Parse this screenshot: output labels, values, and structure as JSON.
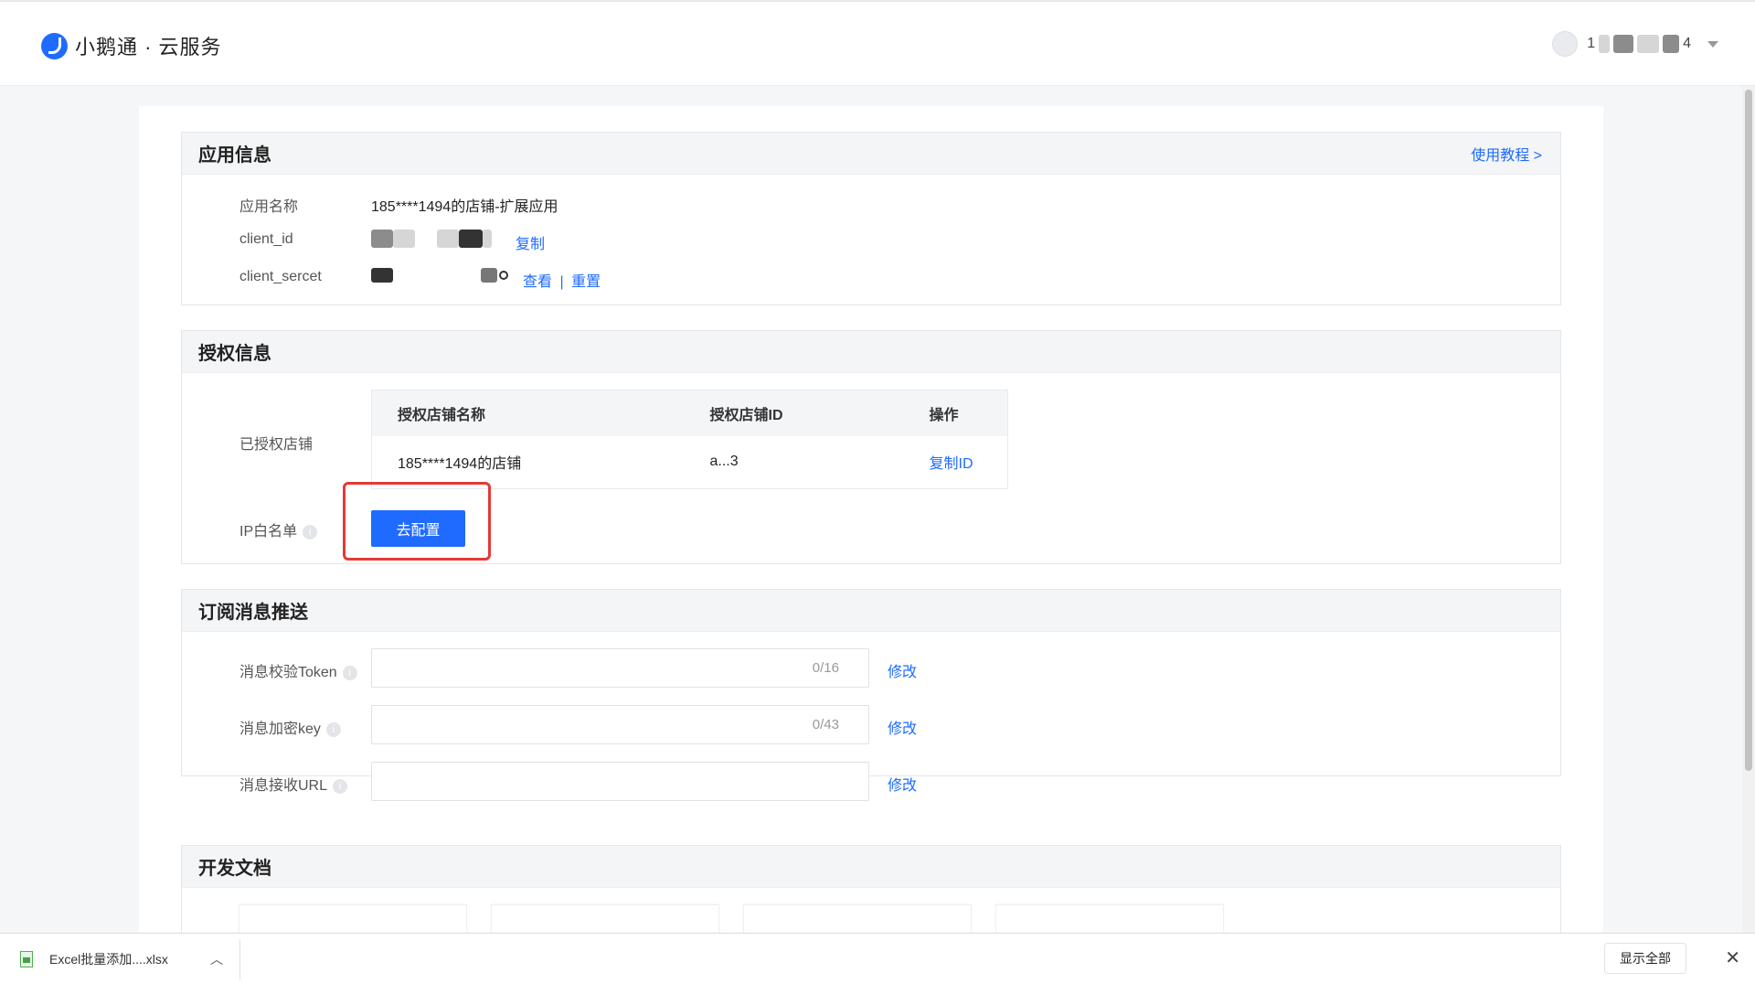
{
  "header": {
    "brand": "小鹅通 · 云服务",
    "user_visible_chars": "1",
    "user_visible_tail": "4"
  },
  "app_info": {
    "title": "应用信息",
    "tutorial_link": "使用教程 >",
    "fields": {
      "name_label": "应用名称",
      "name_value": "185****1494的店铺-扩展应用",
      "client_id_label": "client_id",
      "client_id_copy": "复制",
      "client_secret_label": "client_sercet",
      "secret_view": "查看",
      "secret_sep": "|",
      "secret_reset": "重置"
    }
  },
  "auth_info": {
    "title": "授权信息",
    "authorized_label": "已授权店铺",
    "table": {
      "headers": [
        "授权店铺名称",
        "授权店铺ID",
        "操作"
      ],
      "rows": [
        {
          "name": "185****1494的店铺",
          "id": "a...3",
          "action": "复制ID"
        }
      ]
    },
    "ip_label": "IP白名单",
    "config_button": "去配置"
  },
  "subscription": {
    "title": "订阅消息推送",
    "fields": [
      {
        "label": "消息校验Token",
        "count": "0/16",
        "action": "修改"
      },
      {
        "label": "消息加密key",
        "count": "0/43",
        "action": "修改"
      },
      {
        "label": "消息接收URL",
        "count": "",
        "action": "修改"
      }
    ]
  },
  "dev_docs": {
    "title": "开发文档"
  },
  "download_bar": {
    "file_name": "Excel批量添加....xlsx",
    "show_all": "显示全部"
  },
  "icons": {
    "info": "info-icon",
    "close": "close-icon",
    "chevron": "chevron-up-icon"
  },
  "colors": {
    "primary": "#1f6bff",
    "highlight": "#e53935"
  }
}
